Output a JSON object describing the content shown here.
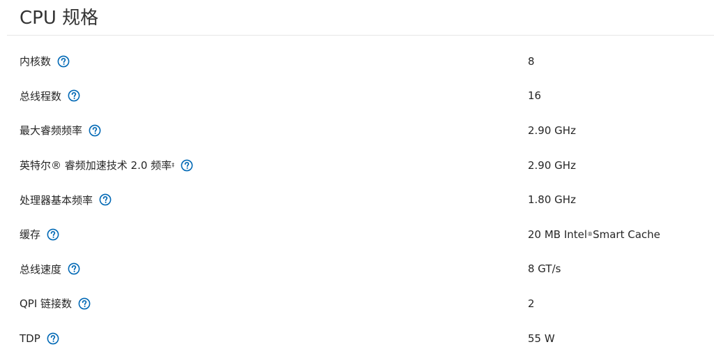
{
  "section": {
    "title": "CPU 规格"
  },
  "icons": {
    "help": "question-circle-icon",
    "help_color": "#0068b5"
  },
  "specs": [
    {
      "label": "内核数",
      "sup": "",
      "value": "8",
      "value_sup": "",
      "value_suffix": ""
    },
    {
      "label": "总线程数",
      "sup": "",
      "value": "16",
      "value_sup": "",
      "value_suffix": ""
    },
    {
      "label": "最大睿频频率",
      "sup": "",
      "value": "2.90 GHz",
      "value_sup": "",
      "value_suffix": ""
    },
    {
      "label": "英特尔® 睿频加速技术 2.0 频率",
      "sup": "‡",
      "value": "2.90 GHz",
      "value_sup": "",
      "value_suffix": ""
    },
    {
      "label": "处理器基本频率",
      "sup": "",
      "value": "1.80 GHz",
      "value_sup": "",
      "value_suffix": ""
    },
    {
      "label": "缓存",
      "sup": "",
      "value": "20 MB Intel",
      "value_sup": "®",
      "value_suffix": " Smart Cache"
    },
    {
      "label": "总线速度",
      "sup": "",
      "value": "8 GT/s",
      "value_sup": "",
      "value_suffix": ""
    },
    {
      "label": "QPI 链接数",
      "sup": "",
      "value": "2",
      "value_sup": "",
      "value_suffix": ""
    },
    {
      "label": "TDP",
      "sup": "",
      "value": "55 W",
      "value_sup": "",
      "value_suffix": ""
    }
  ]
}
